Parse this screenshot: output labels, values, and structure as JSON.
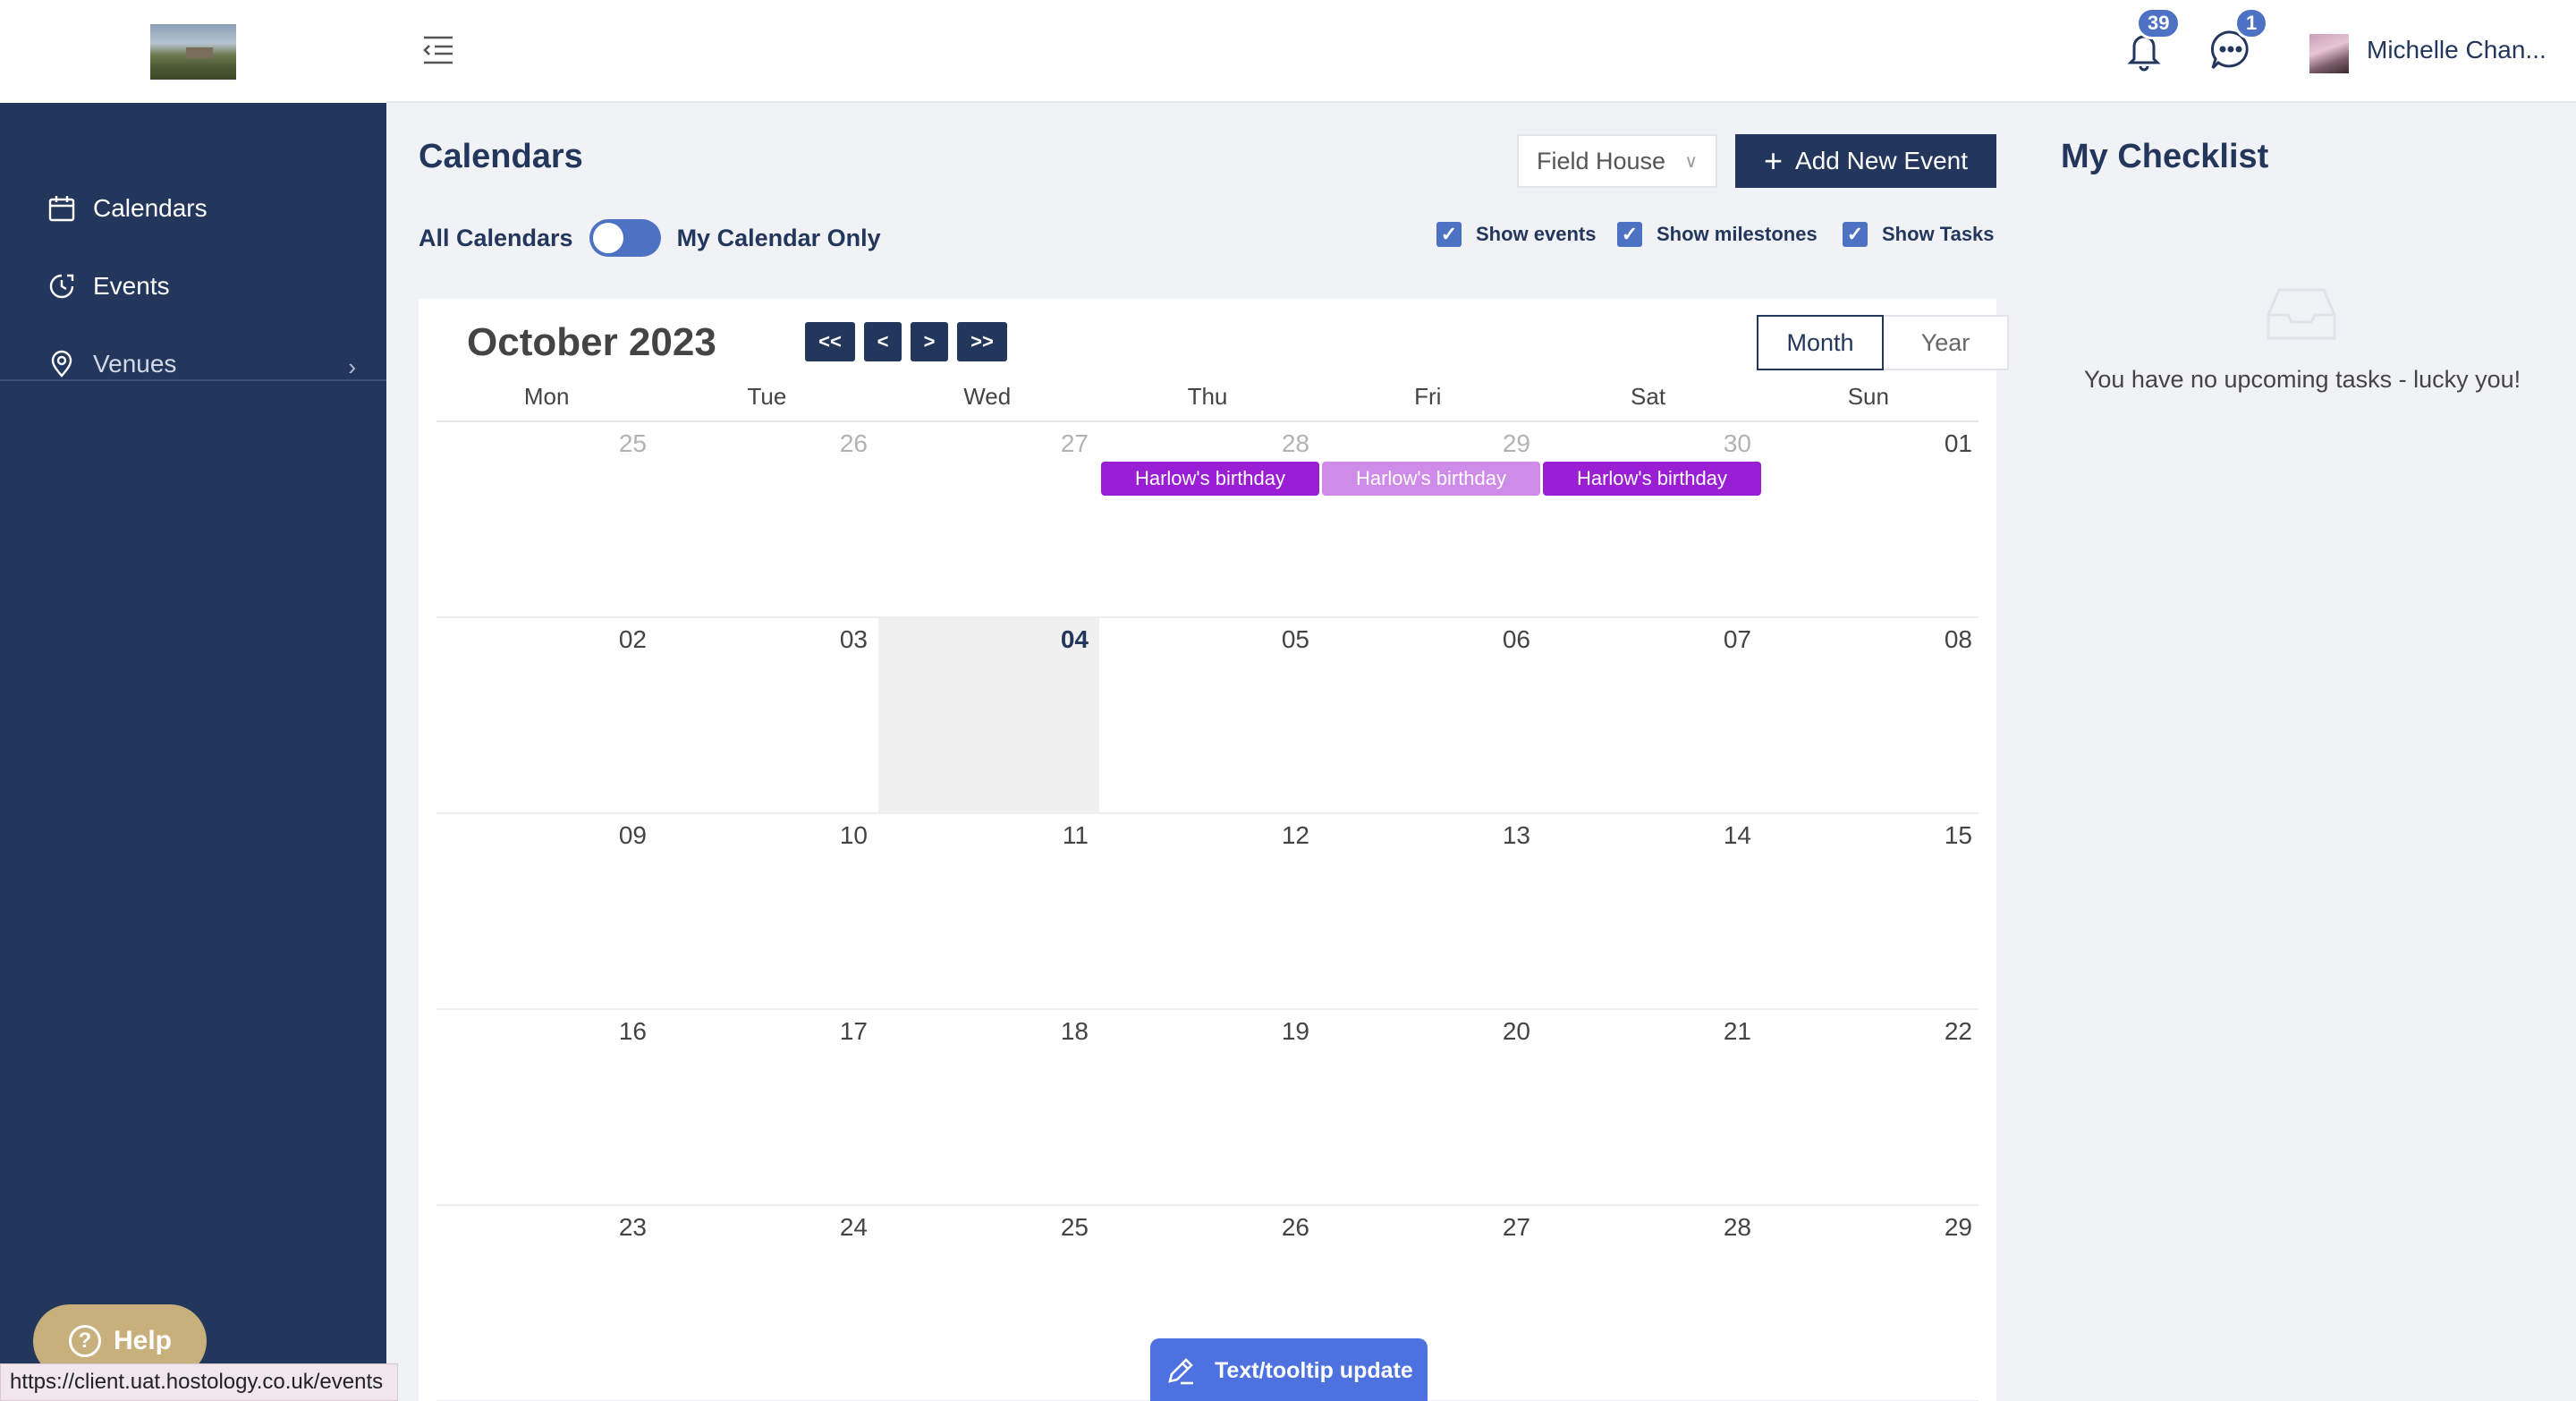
{
  "sidebar": {
    "items": [
      {
        "label": "Calendars",
        "icon": "calendar-icon"
      },
      {
        "label": "Events",
        "icon": "clock-icon"
      },
      {
        "label": "Venues",
        "icon": "location-pin-icon"
      }
    ]
  },
  "topbar": {
    "notifications_count": "39",
    "messages_count": "1",
    "user_name": "Michelle Chan..."
  },
  "main": {
    "title": "Calendars",
    "venue_select": "Field House",
    "add_event_label": "Add New Event",
    "toggle_left": "All Calendars",
    "toggle_right": "My Calendar Only",
    "checks": {
      "events": "Show events",
      "milestones": "Show milestones",
      "tasks": "Show Tasks"
    }
  },
  "calendar": {
    "month_title": "October 2023",
    "nav": {
      "first": "<<",
      "prev": "<",
      "next": ">",
      "last": ">>"
    },
    "views": {
      "month": "Month",
      "year": "Year"
    },
    "weekdays": [
      "Mon",
      "Tue",
      "Wed",
      "Thu",
      "Fri",
      "Sat",
      "Sun"
    ],
    "weeks": [
      [
        "25",
        "26",
        "27",
        "28",
        "29",
        "30",
        "01"
      ],
      [
        "02",
        "03",
        "04",
        "05",
        "06",
        "07",
        "08"
      ],
      [
        "09",
        "10",
        "11",
        "12",
        "13",
        "14",
        "15"
      ],
      [
        "16",
        "17",
        "18",
        "19",
        "20",
        "21",
        "22"
      ],
      [
        "23",
        "24",
        "25",
        "26",
        "27",
        "28",
        "29"
      ]
    ],
    "events": [
      "Harlow's birthday",
      "Harlow's birthday",
      "Harlow's birthday"
    ],
    "colors": {
      "event": "#9a1fd4",
      "event_light": "#cf8be8",
      "brand": "#23365c",
      "accent": "#4d72c4"
    }
  },
  "checklist": {
    "title": "My Checklist",
    "empty_message": "You have no upcoming tasks - lucky you!"
  },
  "help_label": "Help",
  "status_url": "https://client.uat.hostology.co.uk/events",
  "feedback_label": "Text/tooltip update"
}
